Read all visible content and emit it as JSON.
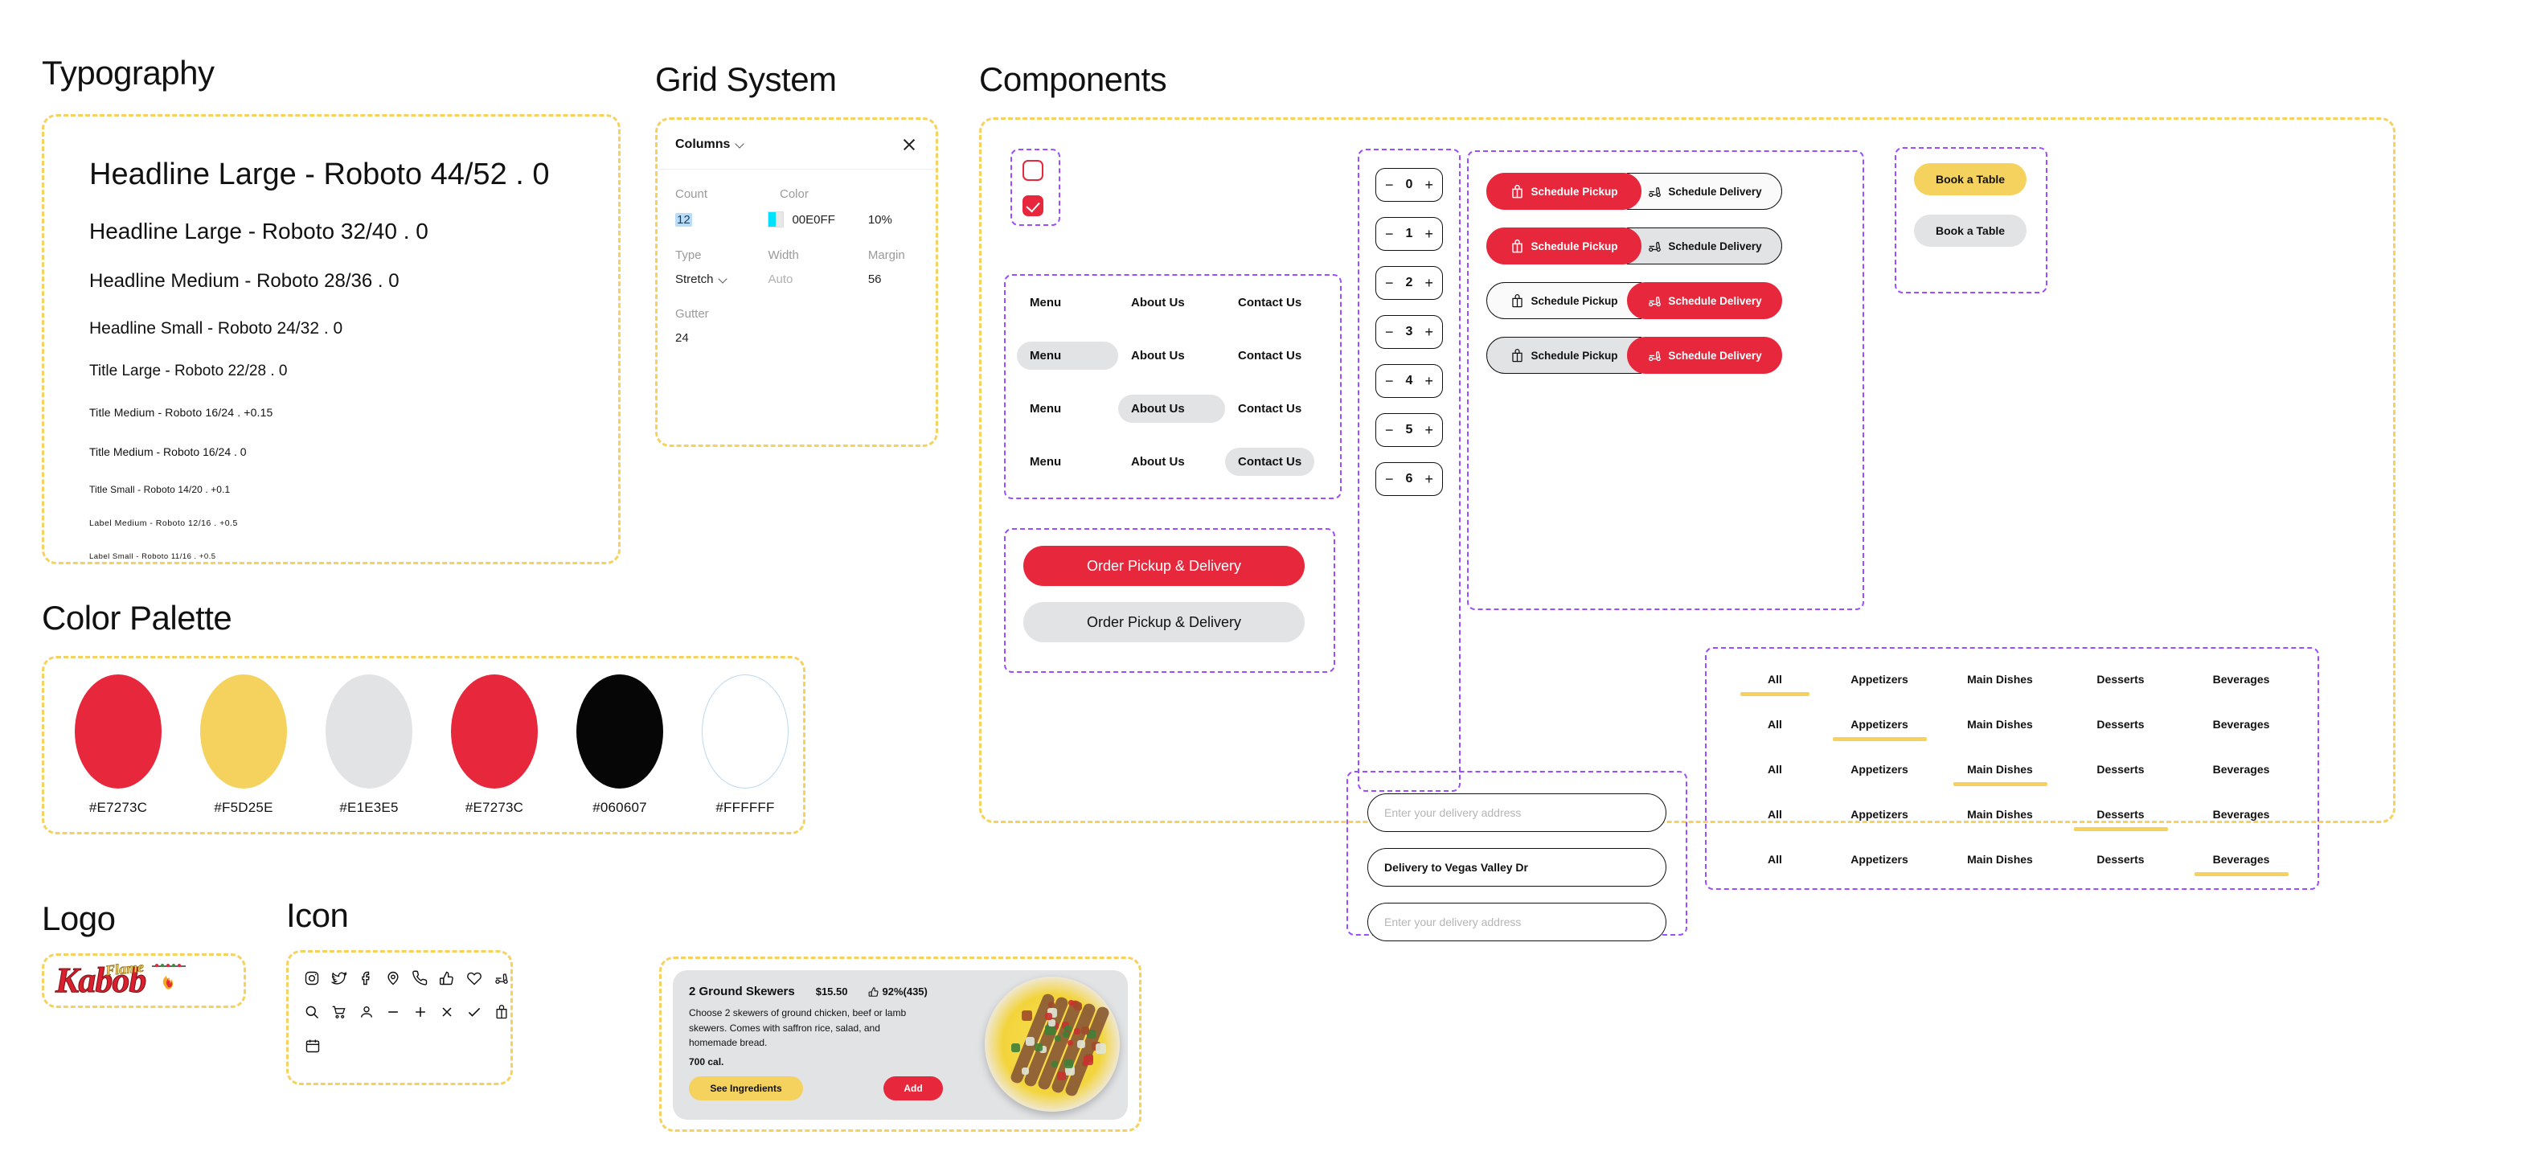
{
  "sections": {
    "typography": "Typography",
    "grid": "Grid System",
    "components": "Components",
    "palette": "Color Palette",
    "logo": "Logo",
    "icon": "Icon"
  },
  "typography": {
    "scale": [
      "Headline Large - Roboto 44/52 . 0",
      "Headline Large - Roboto 32/40 . 0",
      "Headline Medium - Roboto 28/36 . 0",
      "Headline Small - Roboto 24/32 . 0",
      "Title Large - Roboto 22/28 . 0",
      "Title Medium - Roboto 16/24 . +0.15",
      "Title Medium - Roboto 16/24 . 0",
      "Title Small - Roboto 14/20 . +0.1",
      "Label Medium - Roboto 12/16 . +0.5",
      "Label Small - Roboto 11/16 . +0.5"
    ]
  },
  "grid_panel": {
    "title": "Columns",
    "close_icon": "close-icon",
    "labels": {
      "count": "Count",
      "color": "Color",
      "type": "Type",
      "width": "Width",
      "margin": "Margin",
      "gutter": "Gutter"
    },
    "values": {
      "count": "12",
      "color_hex": "00E0FF",
      "color_opacity": "10%",
      "type": "Stretch",
      "width": "Auto",
      "margin": "56",
      "gutter": "24"
    },
    "swatch_color": "#00E0FF"
  },
  "palette": {
    "swatches": [
      {
        "hex": "#E7273C",
        "label": "#E7273C"
      },
      {
        "hex": "#F5D25E",
        "label": "#F5D25E"
      },
      {
        "hex": "#E1E3E5",
        "label": "#E1E3E5"
      },
      {
        "hex": "#E7273C",
        "label": "#E7273C"
      },
      {
        "hex": "#060607",
        "label": "#060607"
      },
      {
        "hex": "#FFFFFF",
        "label": "#FFFFFF"
      }
    ]
  },
  "components": {
    "checkbox": {
      "unchecked": "checkbox-unchecked",
      "checked": "checkbox-checked"
    },
    "nav_rows": [
      {
        "items": [
          "Menu",
          "About Us",
          "Contact Us"
        ],
        "active": -1
      },
      {
        "items": [
          "Menu",
          "About Us",
          "Contact Us"
        ],
        "active": 0
      },
      {
        "items": [
          "Menu",
          "About Us",
          "Contact Us"
        ],
        "active": 1
      },
      {
        "items": [
          "Menu",
          "About Us",
          "Contact Us"
        ],
        "active": 2
      }
    ],
    "order_buttons": [
      {
        "label": "Order Pickup & Delivery",
        "style": "primary"
      },
      {
        "label": "Order Pickup & Delivery",
        "style": "secondary"
      }
    ],
    "steppers": [
      "0",
      "1",
      "2",
      "3",
      "4",
      "5",
      "6"
    ],
    "stepper_minus": "−",
    "stepper_plus": "+",
    "address_inputs": [
      {
        "placeholder": "Enter your delivery address",
        "value": ""
      },
      {
        "placeholder": "Enter your delivery address",
        "value": "Delivery to Vegas Valley Dr"
      },
      {
        "placeholder": "Enter your delivery address",
        "value": ""
      }
    ],
    "schedule_toggles": [
      {
        "pickup": "Schedule Pickup",
        "delivery": "Schedule Delivery",
        "selected": "pickup",
        "variant": "white"
      },
      {
        "pickup": "Schedule Pickup",
        "delivery": "Schedule Delivery",
        "selected": "pickup",
        "variant": "gray"
      },
      {
        "pickup": "Schedule Pickup",
        "delivery": "Schedule Delivery",
        "selected": "delivery",
        "variant": "white"
      },
      {
        "pickup": "Schedule Pickup",
        "delivery": "Schedule Delivery",
        "selected": "delivery",
        "variant": "gray"
      }
    ],
    "book_table": [
      {
        "label": "Book a Table",
        "style": "yellow"
      },
      {
        "label": "Book a Table",
        "style": "gray"
      }
    ],
    "category_tabs": {
      "items": [
        "All",
        "Appetizers",
        "Main Dishes",
        "Desserts",
        "Beverages"
      ],
      "rows": [
        0,
        1,
        2,
        3,
        4
      ]
    }
  },
  "logo": {
    "word": "Kabob",
    "script": "Flame"
  },
  "icons": {
    "row1": [
      "instagram-icon",
      "twitter-icon",
      "facebook-icon",
      "location-pin-icon",
      "phone-icon",
      "thumbs-up-icon",
      "heart-icon",
      "scooter-icon"
    ],
    "row2": [
      "search-icon",
      "shopping-cart-icon",
      "person-icon",
      "minus-icon",
      "plus-icon",
      "close-icon",
      "check-icon",
      "shopping-bag-icon"
    ],
    "row3": [
      "calendar-icon"
    ]
  },
  "food_card": {
    "title": "2 Ground Skewers",
    "price": "$15.50",
    "rating": "92%(435)",
    "description": "Choose 2 skewers of ground chicken, beef or lamb skewers. Comes with saffron rice, salad, and homemade bread.",
    "calories": "700 cal.",
    "see_ingredients": "See Ingredients",
    "add": "Add"
  },
  "colors": {
    "red": "#E7273C",
    "yellow": "#F5D25E",
    "gray": "#E1E3E5",
    "black": "#060607",
    "white": "#FFFFFF",
    "dash_outer": "#F5D25E",
    "dash_inner": "#9B4DFF"
  }
}
